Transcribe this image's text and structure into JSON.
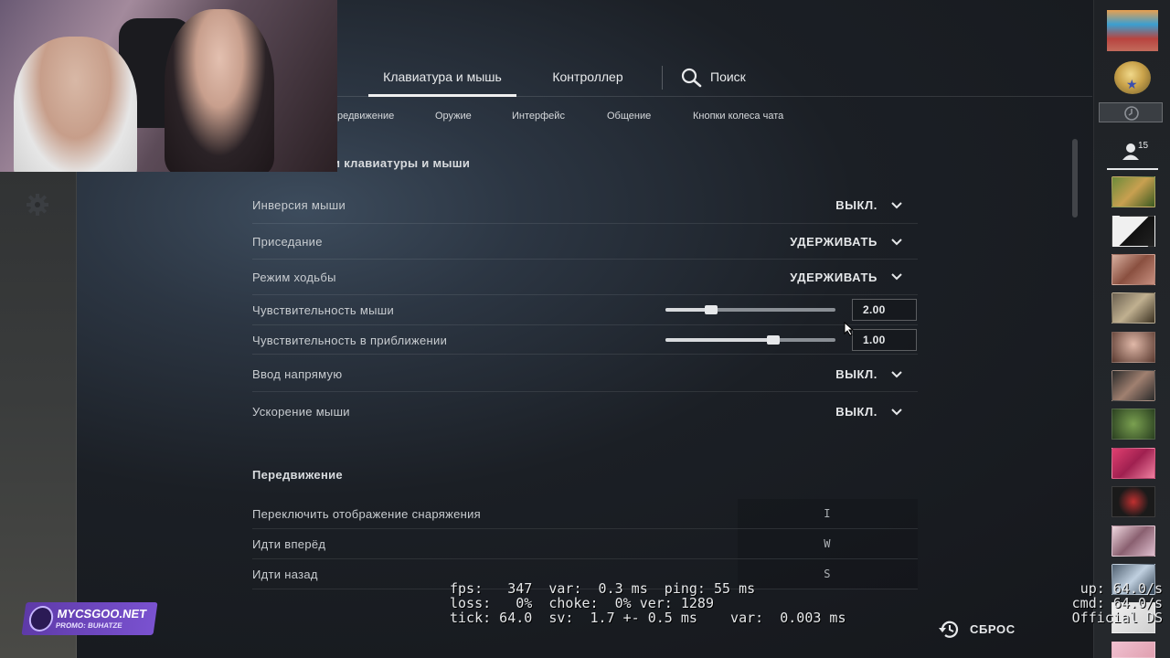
{
  "topnav": {
    "tabs": [
      {
        "label": "Клавиатура и мышь",
        "active": true
      },
      {
        "label": "Контроллер",
        "active": false
      }
    ],
    "search_label": "Поиск"
  },
  "subnav": {
    "items": [
      "редвижение",
      "Оружие",
      "Интерфейс",
      "Общение",
      "Кнопки колеса чата"
    ]
  },
  "sections": {
    "keyboard_mouse_title": "и клавиатуры и мыши",
    "movement_title": "Передвижение"
  },
  "settings": [
    {
      "label": "Инверсия мыши",
      "value": "ВЫКЛ."
    },
    {
      "label": "Приседание",
      "value": "УДЕРЖИВАТЬ"
    },
    {
      "label": "Режим ходьбы",
      "value": "УДЕРЖИВАТЬ"
    },
    {
      "label": "Чувствительность мыши",
      "value": "2.00",
      "slider": 0.27
    },
    {
      "label": "Чувствительность в приближении",
      "value": "1.00",
      "slider": 0.635
    },
    {
      "label": "Ввод напрямую",
      "value": "ВЫКЛ."
    },
    {
      "label": "Ускорение мыши",
      "value": "ВЫКЛ."
    }
  ],
  "keybinds": [
    {
      "label": "Переключить отображение снаряжения",
      "key": "I"
    },
    {
      "label": "Идти вперёд",
      "key": "W"
    },
    {
      "label": "Идти назад",
      "key": "S"
    }
  ],
  "friends_count": "15",
  "netgraph": {
    "line1": "fps:   347  var:  0.3 ms  ping: 55 ms",
    "line2": "loss:   0%  choke:  0% ver: 1289",
    "line3": "tick: 64.0  sv:  1.7 +- 0.5 ms    var:  0.003 ms",
    "right1": "up: 64.0/s",
    "right2": "cmd: 64.0/s",
    "right3": "Official DS"
  },
  "reset_label": "СБРОС",
  "logo": {
    "name": "MYCSGOO.NET",
    "promo": "PROMO: BUHATZE"
  },
  "colors": {
    "accent": "#e6e8ea",
    "background": "#1b1f25",
    "logo": "#6a45bf"
  }
}
